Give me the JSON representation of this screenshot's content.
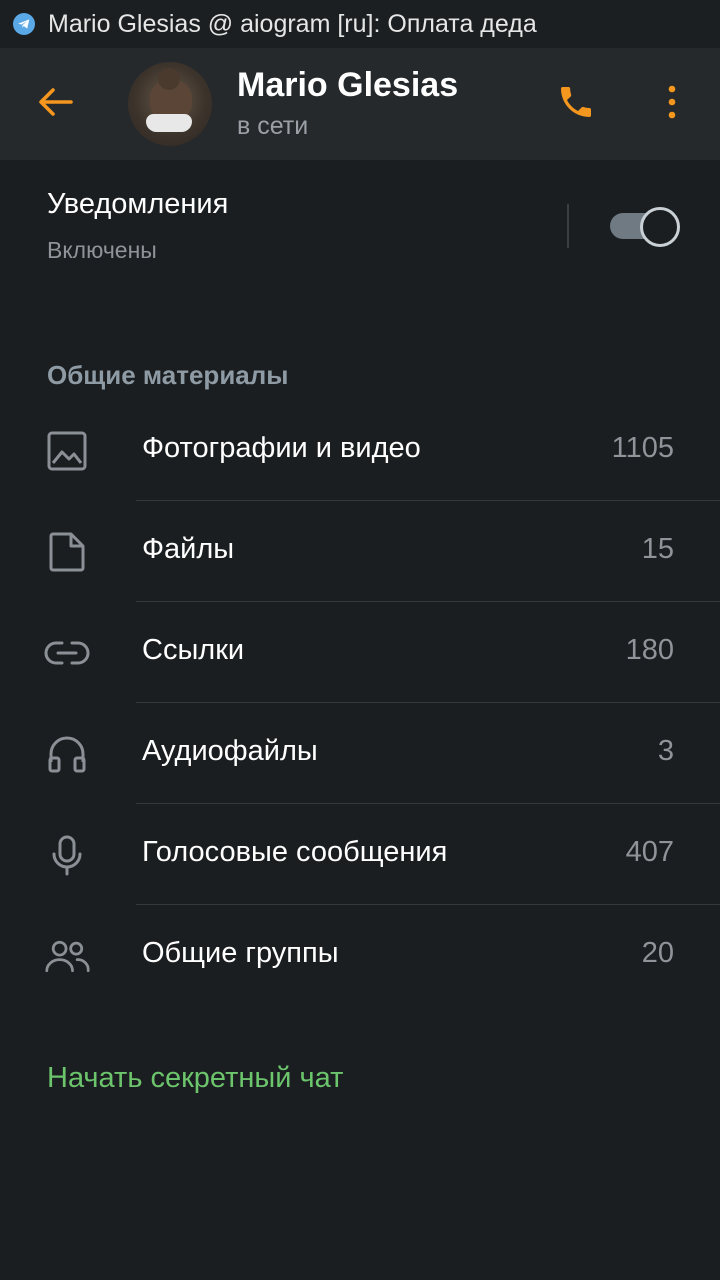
{
  "statusbar": {
    "title": "Mario Glesias @ aiogram [ru]: Оплата деда",
    "icon": "telegram-icon"
  },
  "header": {
    "back_icon": "arrow-left-icon",
    "name": "Mario Glesias",
    "status": "в сети",
    "call_icon": "phone-icon",
    "menu_icon": "more-vertical-icon",
    "accent_color": "#f5961e"
  },
  "notifications": {
    "title": "Уведомления",
    "state": "Включены",
    "enabled": true
  },
  "shared_media": {
    "header": "Общие материалы",
    "items": [
      {
        "icon": "image-icon",
        "label": "Фотографии и видео",
        "count": "1105"
      },
      {
        "icon": "file-icon",
        "label": "Файлы",
        "count": "15"
      },
      {
        "icon": "link-icon",
        "label": "Ссылки",
        "count": "180"
      },
      {
        "icon": "headphones-icon",
        "label": "Аудиофайлы",
        "count": "3"
      },
      {
        "icon": "microphone-icon",
        "label": "Голосовые сообщения",
        "count": "407"
      },
      {
        "icon": "users-icon",
        "label": "Общие группы",
        "count": "20"
      }
    ]
  },
  "secret_chat": {
    "label": "Начать секретный чат",
    "color": "#6cc56c"
  }
}
